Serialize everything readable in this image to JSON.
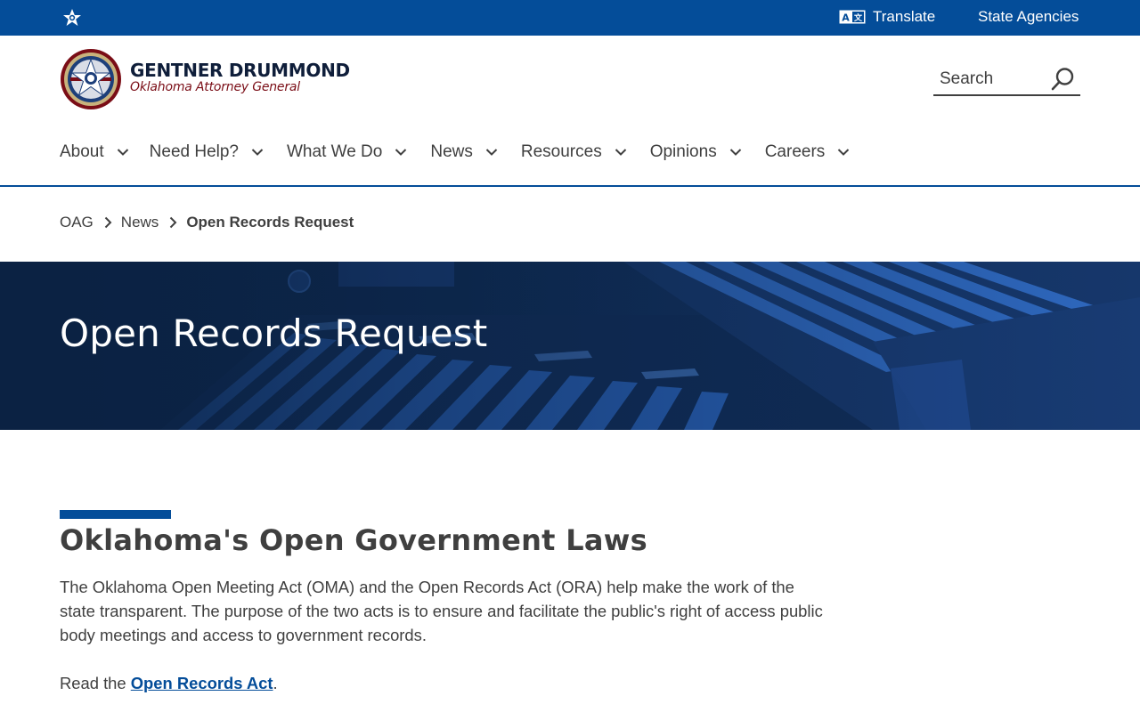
{
  "topbar": {
    "translate_label": "Translate",
    "agencies_label": "State Agencies"
  },
  "brand": {
    "name": "GENTNER DRUMMOND",
    "office": "Oklahoma Attorney General"
  },
  "search": {
    "placeholder": "Search"
  },
  "nav": {
    "items": [
      {
        "label": "About"
      },
      {
        "label": "Need Help?"
      },
      {
        "label": "What We Do"
      },
      {
        "label": "News"
      },
      {
        "label": "Resources"
      },
      {
        "label": "Opinions"
      },
      {
        "label": "Careers"
      }
    ]
  },
  "breadcrumb": {
    "items": [
      "OAG",
      "News"
    ],
    "current": "Open Records Request"
  },
  "hero": {
    "title": "Open Records Request"
  },
  "content": {
    "heading": "Oklahoma's Open Government Laws",
    "intro": "The Oklahoma Open Meeting Act (OMA) and the Open Records Act (ORA) help make the work of the state transparent. The purpose of the two acts is to ensure and facilitate the public's right of access public body meetings and access to government records.",
    "read_prefix": "Read the ",
    "read_link": "Open Records Act",
    "read_suffix": "."
  },
  "colors": {
    "brand_blue": "#044d99",
    "navy": "#0f1e3a",
    "maroon": "#7a0d16",
    "text": "#3f3f3f"
  }
}
